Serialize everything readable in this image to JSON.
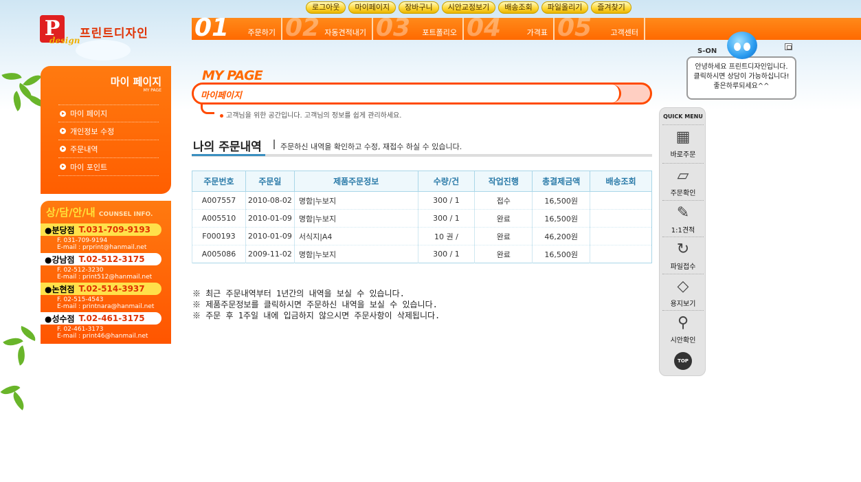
{
  "top_links": [
    "로그아웃",
    "마이페이지",
    "장바구니",
    "시안교정보기",
    "배송조회",
    "파일올리기",
    "즐겨찾기"
  ],
  "logo": {
    "letter": "P",
    "script": "design",
    "name": "프린트디자인"
  },
  "nav": [
    {
      "num": "01",
      "label": "주문하기"
    },
    {
      "num": "02",
      "label": "자동견적내기"
    },
    {
      "num": "03",
      "label": "포트폴리오"
    },
    {
      "num": "04",
      "label": "가격표"
    },
    {
      "num": "05",
      "label": "고객센터"
    }
  ],
  "sidebar": {
    "title": "마이 페이지",
    "subtitle": "MY PAGE",
    "items": [
      "마이 페이지",
      "개인정보 수정",
      "주문내역",
      "마이 포인트"
    ]
  },
  "counsel": {
    "title": "상/담/안/내",
    "title_en": "COUNSEL INFO.",
    "branches": [
      {
        "name": "●분당점",
        "tel": "T.031-709-9193",
        "fax": "F. 031-709-9194",
        "email": "E-mail : prprint@hanmail.net",
        "style": "y"
      },
      {
        "name": "●강남점",
        "tel": "T.02-512-3175",
        "fax": "F. 02-512-3230",
        "email": "E-mail : print512@hanmail.net",
        "style": "w"
      },
      {
        "name": "●논현점",
        "tel": "T.02-514-3937",
        "fax": "F. 02-515-4543",
        "email": "E-mail : printnara@hanmail.net",
        "style": "y"
      },
      {
        "name": "●성수점",
        "tel": "T.02-461-3175",
        "fax": "F. 02-461-3173",
        "email": "E-mail : print46@hanmail.net",
        "style": "w"
      }
    ]
  },
  "main": {
    "page_heading": "MY PAGE",
    "crumb_label": "마이페이지",
    "crumb_desc": "고객님을 위한 공간입니다. 고객님의 정보를 쉽게 관리하세요.",
    "section_title": "나의 주문내역",
    "section_desc": "주문하신 내역을 확인하고 수정, 재접수 하실 수 있습니다.",
    "table": {
      "headers": [
        "주문번호",
        "주문일",
        "제품주문정보",
        "수량/건",
        "작업진행",
        "총결제금액",
        "배송조회"
      ],
      "rows": [
        [
          "A007557",
          "2010-08-02",
          "명함|누보지",
          "300 / 1",
          "접수",
          "16,500원",
          ""
        ],
        [
          "A005510",
          "2010-01-09",
          "명함|누보지",
          "300 / 1",
          "완료",
          "16,500원",
          ""
        ],
        [
          "F000193",
          "2010-01-09",
          "서식지|A4",
          "10 권 /",
          "완료",
          "46,200원",
          ""
        ],
        [
          "A005086",
          "2009-11-02",
          "명함|누보지",
          "300 / 1",
          "완료",
          "16,500원",
          ""
        ]
      ]
    },
    "notes": [
      "※ 최근 주문내역부터 1년간의 내역을 보실 수 있습니다.",
      "※ 제품주문정보를 클릭하시면 주문하신 내역을 보실 수 있습니다.",
      "※ 주문 후 1주일 내에 입금하지 않으시면 주문사항이 삭제됩니다."
    ]
  },
  "chat": {
    "brand": "S-ON",
    "lines": [
      "안녕하세요 프린트디자인입니다.",
      "클릭하시면 상담이 가능하십니다!",
      "좋은하루되세요^^"
    ]
  },
  "quick_menu": {
    "title": "QUICK MENU",
    "items": [
      {
        "icon": "calculator-icon",
        "label": "바로주문"
      },
      {
        "icon": "book-icon",
        "label": "주문확인"
      },
      {
        "icon": "notepad-icon",
        "label": "1:1견적"
      },
      {
        "icon": "refresh-icon",
        "label": "파일접수"
      },
      {
        "icon": "paper-icon",
        "label": "용지보기"
      },
      {
        "icon": "magnifier-icon",
        "label": "시안확인"
      }
    ],
    "top_label": "TOP"
  },
  "colors": {
    "accent": "#ff6a00",
    "crumb_border": "#ff4a00",
    "table_header": "#2a7aa8",
    "table_border": "#a9d6e8"
  }
}
